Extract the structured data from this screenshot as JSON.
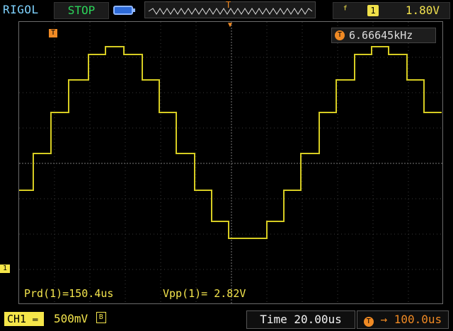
{
  "header": {
    "brand": "RIGOL",
    "run_status": "STOP",
    "trigger_level": "1.80V",
    "trigger_source": "1",
    "trigger_slope_icon": "rising-edge-icon"
  },
  "screen": {
    "frequency_readout": "6.66645kHz",
    "trigger_marker_label": "T",
    "channel_marker_label": "1"
  },
  "measurements": {
    "period": "Prd(1)=150.4us",
    "vpp": "Vpp(1)= 2.82V"
  },
  "footer": {
    "channel": "CH1",
    "volts_per_div": "500mV",
    "bandwidth_limit": "B",
    "timebase": "Time 20.00us",
    "trigger_offset": "100.0us"
  },
  "colors": {
    "trace": "#d6cc22",
    "grid": "#6b6b6b",
    "accent_orange": "#f08a24",
    "status_green": "#2bd65a"
  },
  "waveform": {
    "description_values_in_divisions": [
      -0.7,
      0.3,
      1.0,
      2.0,
      2.6,
      3.0,
      3.2,
      3.0,
      2.6,
      1.8,
      0.8,
      -0.2,
      -1.2,
      -2.2,
      -2.6,
      -3.0,
      -2.6,
      -1.8,
      -0.8,
      0.3,
      1.0,
      2.0,
      2.6,
      3.0,
      3.2,
      3.0,
      2.6,
      1.8
    ]
  }
}
